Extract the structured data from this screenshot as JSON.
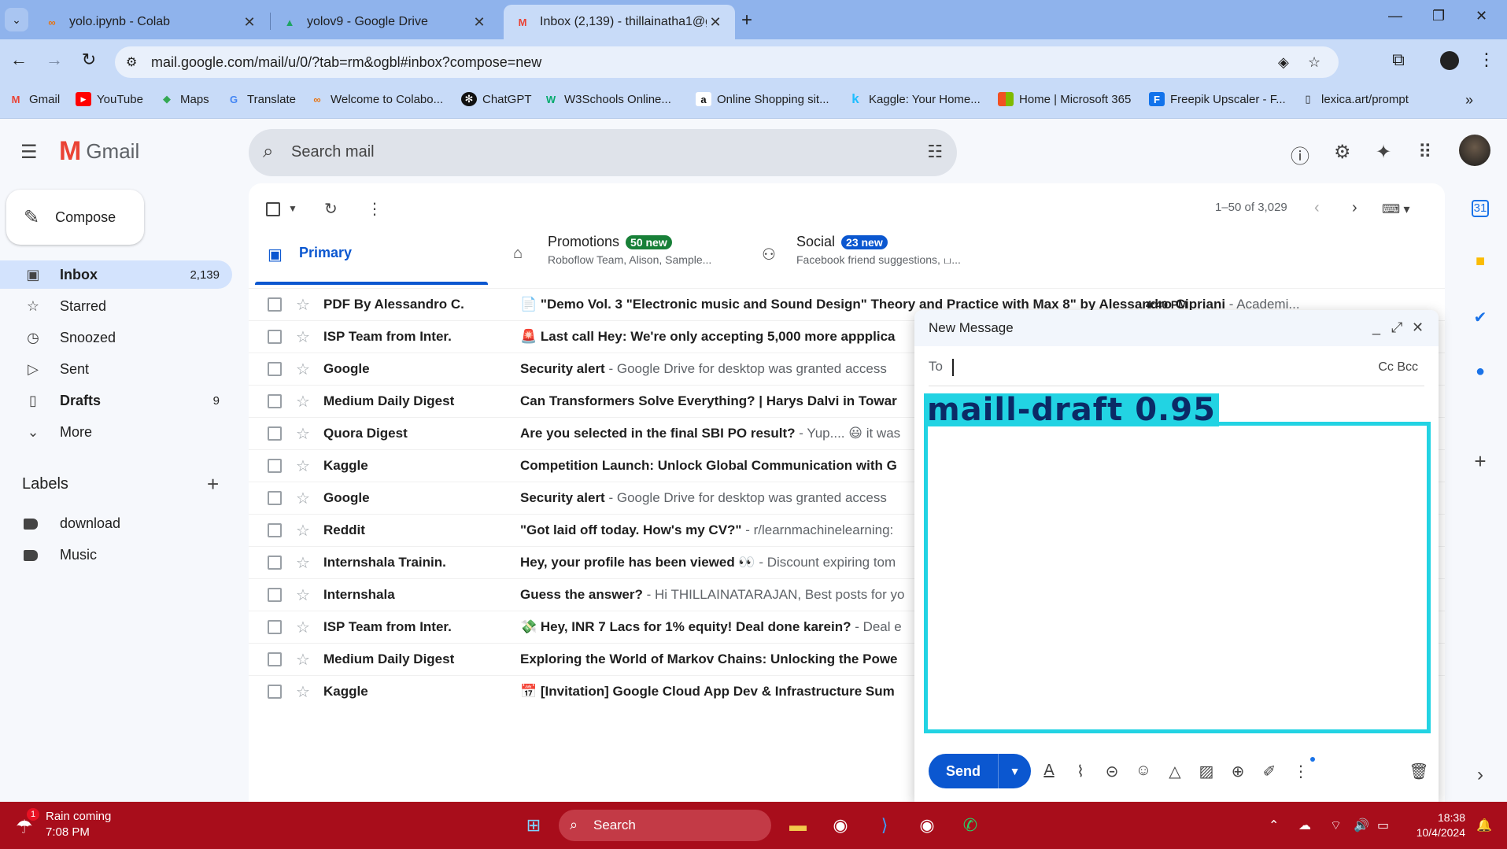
{
  "browser": {
    "tabs": [
      {
        "title": "yolo.ipynb - Colab",
        "favicon": "colab-icon",
        "active": false
      },
      {
        "title": "yolov9 - Google Drive",
        "favicon": "drive-icon",
        "active": false
      },
      {
        "title": "Inbox (2,139) - thillainatha1@g",
        "favicon": "gmail-icon",
        "active": true
      }
    ],
    "url": "mail.google.com/mail/u/0/?tab=rm&ogbl#inbox?compose=new",
    "bookmarks": [
      "Gmail",
      "YouTube",
      "Maps",
      "Translate",
      "Welcome to Colabo...",
      "ChatGPT",
      "W3Schools Online...",
      "Online Shopping sit...",
      "Kaggle: Your Home...",
      "Home | Microsoft 365",
      "Freepik Upscaler - F...",
      "lexica.art/prompt"
    ]
  },
  "gmail": {
    "logo_text": "Gmail",
    "search_placeholder": "Search mail",
    "compose_label": "Compose",
    "nav": [
      {
        "label": "Inbox",
        "count": "2,139",
        "icon": "inbox-icon"
      },
      {
        "label": "Starred",
        "count": "",
        "icon": "star-icon"
      },
      {
        "label": "Snoozed",
        "count": "",
        "icon": "clock-icon"
      },
      {
        "label": "Sent",
        "count": "",
        "icon": "send-icon"
      },
      {
        "label": "Drafts",
        "count": "9",
        "icon": "draft-icon"
      },
      {
        "label": "More",
        "count": "",
        "icon": "chevron-down-icon"
      }
    ],
    "labels_title": "Labels",
    "labels": [
      "download",
      "Music"
    ],
    "pager": "1–50 of 3,029",
    "categories": {
      "primary": "Primary",
      "promotions": {
        "label": "Promotions",
        "badge": "50 new",
        "sub": "Roboflow Team, Alison, Sample..."
      },
      "social": {
        "label": "Social",
        "badge": "23 new",
        "sub": "Facebook friend suggestions, ப..."
      }
    },
    "emails": [
      {
        "sender": "PDF By Alessandro C.",
        "subject": "📄 \"Demo Vol. 3 \"Electronic music and Sound Design\" Theory and Practice with Max 8\" by Alessandro Cipriani",
        "snippet": " - Academi...",
        "time": "4:40 PM"
      },
      {
        "sender": "ISP Team from Inter.",
        "subject": "🚨 Last call Hey: We're only accepting 5,000 more appplica",
        "snippet": "",
        "time": ""
      },
      {
        "sender": "Google",
        "subject": "Security alert",
        "snippet": " - Google Drive for desktop was granted access",
        "time": ""
      },
      {
        "sender": "Medium Daily Digest",
        "subject": "Can Transformers Solve Everything? | Harys Dalvi in Towar",
        "snippet": "",
        "time": ""
      },
      {
        "sender": "Quora Digest",
        "subject": "Are you selected in the final SBI PO result?",
        "snippet": " - Yup.... 😃 it was",
        "time": ""
      },
      {
        "sender": "Kaggle",
        "subject": "Competition Launch: Unlock Global Communication with G",
        "snippet": "",
        "time": ""
      },
      {
        "sender": "Google",
        "subject": "Security alert",
        "snippet": " - Google Drive for desktop was granted access",
        "time": ""
      },
      {
        "sender": "Reddit",
        "subject": "\"Got laid off today. How's my CV?\"",
        "snippet": " - r/learnmachinelearning:",
        "time": ""
      },
      {
        "sender": "Internshala Trainin.",
        "subject": "Hey, your profile has been viewed 👀",
        "snippet": " - Discount expiring tom",
        "time": ""
      },
      {
        "sender": "Internshala",
        "subject": "Guess the answer?",
        "snippet": " - Hi THILLAINATARAJAN, Best posts for yo",
        "time": ""
      },
      {
        "sender": "ISP Team from Inter.",
        "subject": "💸 Hey, INR 7 Lacs for 1% equity! Deal done karein?",
        "snippet": " - Deal e",
        "time": ""
      },
      {
        "sender": "Medium Daily Digest",
        "subject": "Exploring the World of Markov Chains: Unlocking the Powe",
        "snippet": "",
        "time": ""
      },
      {
        "sender": "Kaggle",
        "subject": "📅 [Invitation] Google Cloud App Dev & Infrastructure Sum",
        "snippet": "",
        "time": ""
      }
    ],
    "compose_window": {
      "title": "New Message",
      "to_label": "To",
      "cc_bcc": "Cc Bcc",
      "detection_label": "maill-draft  0.95",
      "send_label": "Send"
    }
  },
  "taskbar": {
    "weather_line1": "Rain coming",
    "weather_line2": "7:08 PM",
    "weather_badge": "1",
    "search_placeholder": "Search",
    "time": "18:38",
    "date": "10/4/2024"
  },
  "colors": {
    "tab_bar": "#8fb3ec",
    "toolbar": "#c8dbf8",
    "accent_blue": "#0b57d0",
    "detection_cyan": "#22d3e3",
    "taskbar": "#a80d1b",
    "badge_green": "#188038",
    "badge_blue": "#0b57d0"
  }
}
